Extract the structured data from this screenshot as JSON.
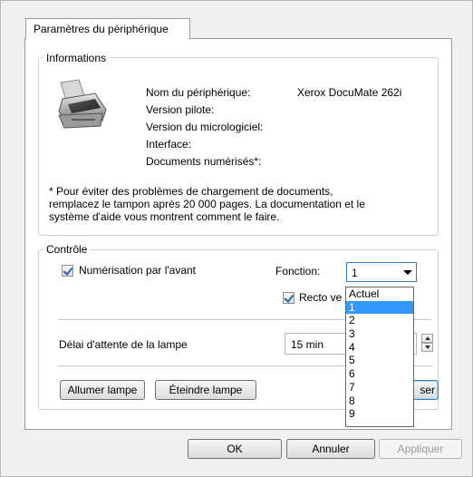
{
  "tab": {
    "label": "Paramètres du périphérique"
  },
  "informations": {
    "legend": "Informations",
    "device_name_label": "Nom du périphérique:",
    "device_name_value": "Xerox DocuMate 262i",
    "driver_version_label": "Version pilote:",
    "firmware_version_label": "Version du micrologiciel:",
    "interface_label": "Interface:",
    "scanned_docs_label": "Documents numérisés*:",
    "footnote_line1": "* Pour éviter des problèmes de chargement de documents,",
    "footnote_line2": "remplacez le tampon après 20 000 pages. La documentation et le",
    "footnote_line3": "système d'aide vous montrent comment le faire."
  },
  "controle": {
    "legend": "Contrôle",
    "front_scan_label": "Numérisation par l'avant",
    "function_label": "Fonction:",
    "function_value": "1",
    "duplex_label": "Recto ve",
    "lamp_delay_label": "Délai d'attente de la lampe",
    "lamp_delay_value": "15 min",
    "lamp_on_button": "Allumer lampe",
    "lamp_off_button": "Éteindre lampe",
    "reset_button_partial": "ser"
  },
  "function_dropdown": {
    "options": [
      "Actuel",
      "1",
      "2",
      "3",
      "4",
      "5",
      "6",
      "7",
      "8",
      "9"
    ],
    "selected_index": 1
  },
  "footer": {
    "ok_button": "OK",
    "cancel_button": "Annuler",
    "apply_button": "Appliquer"
  },
  "colors": {
    "selection": "#3399ff",
    "focus_border": "#3c7fb1"
  }
}
